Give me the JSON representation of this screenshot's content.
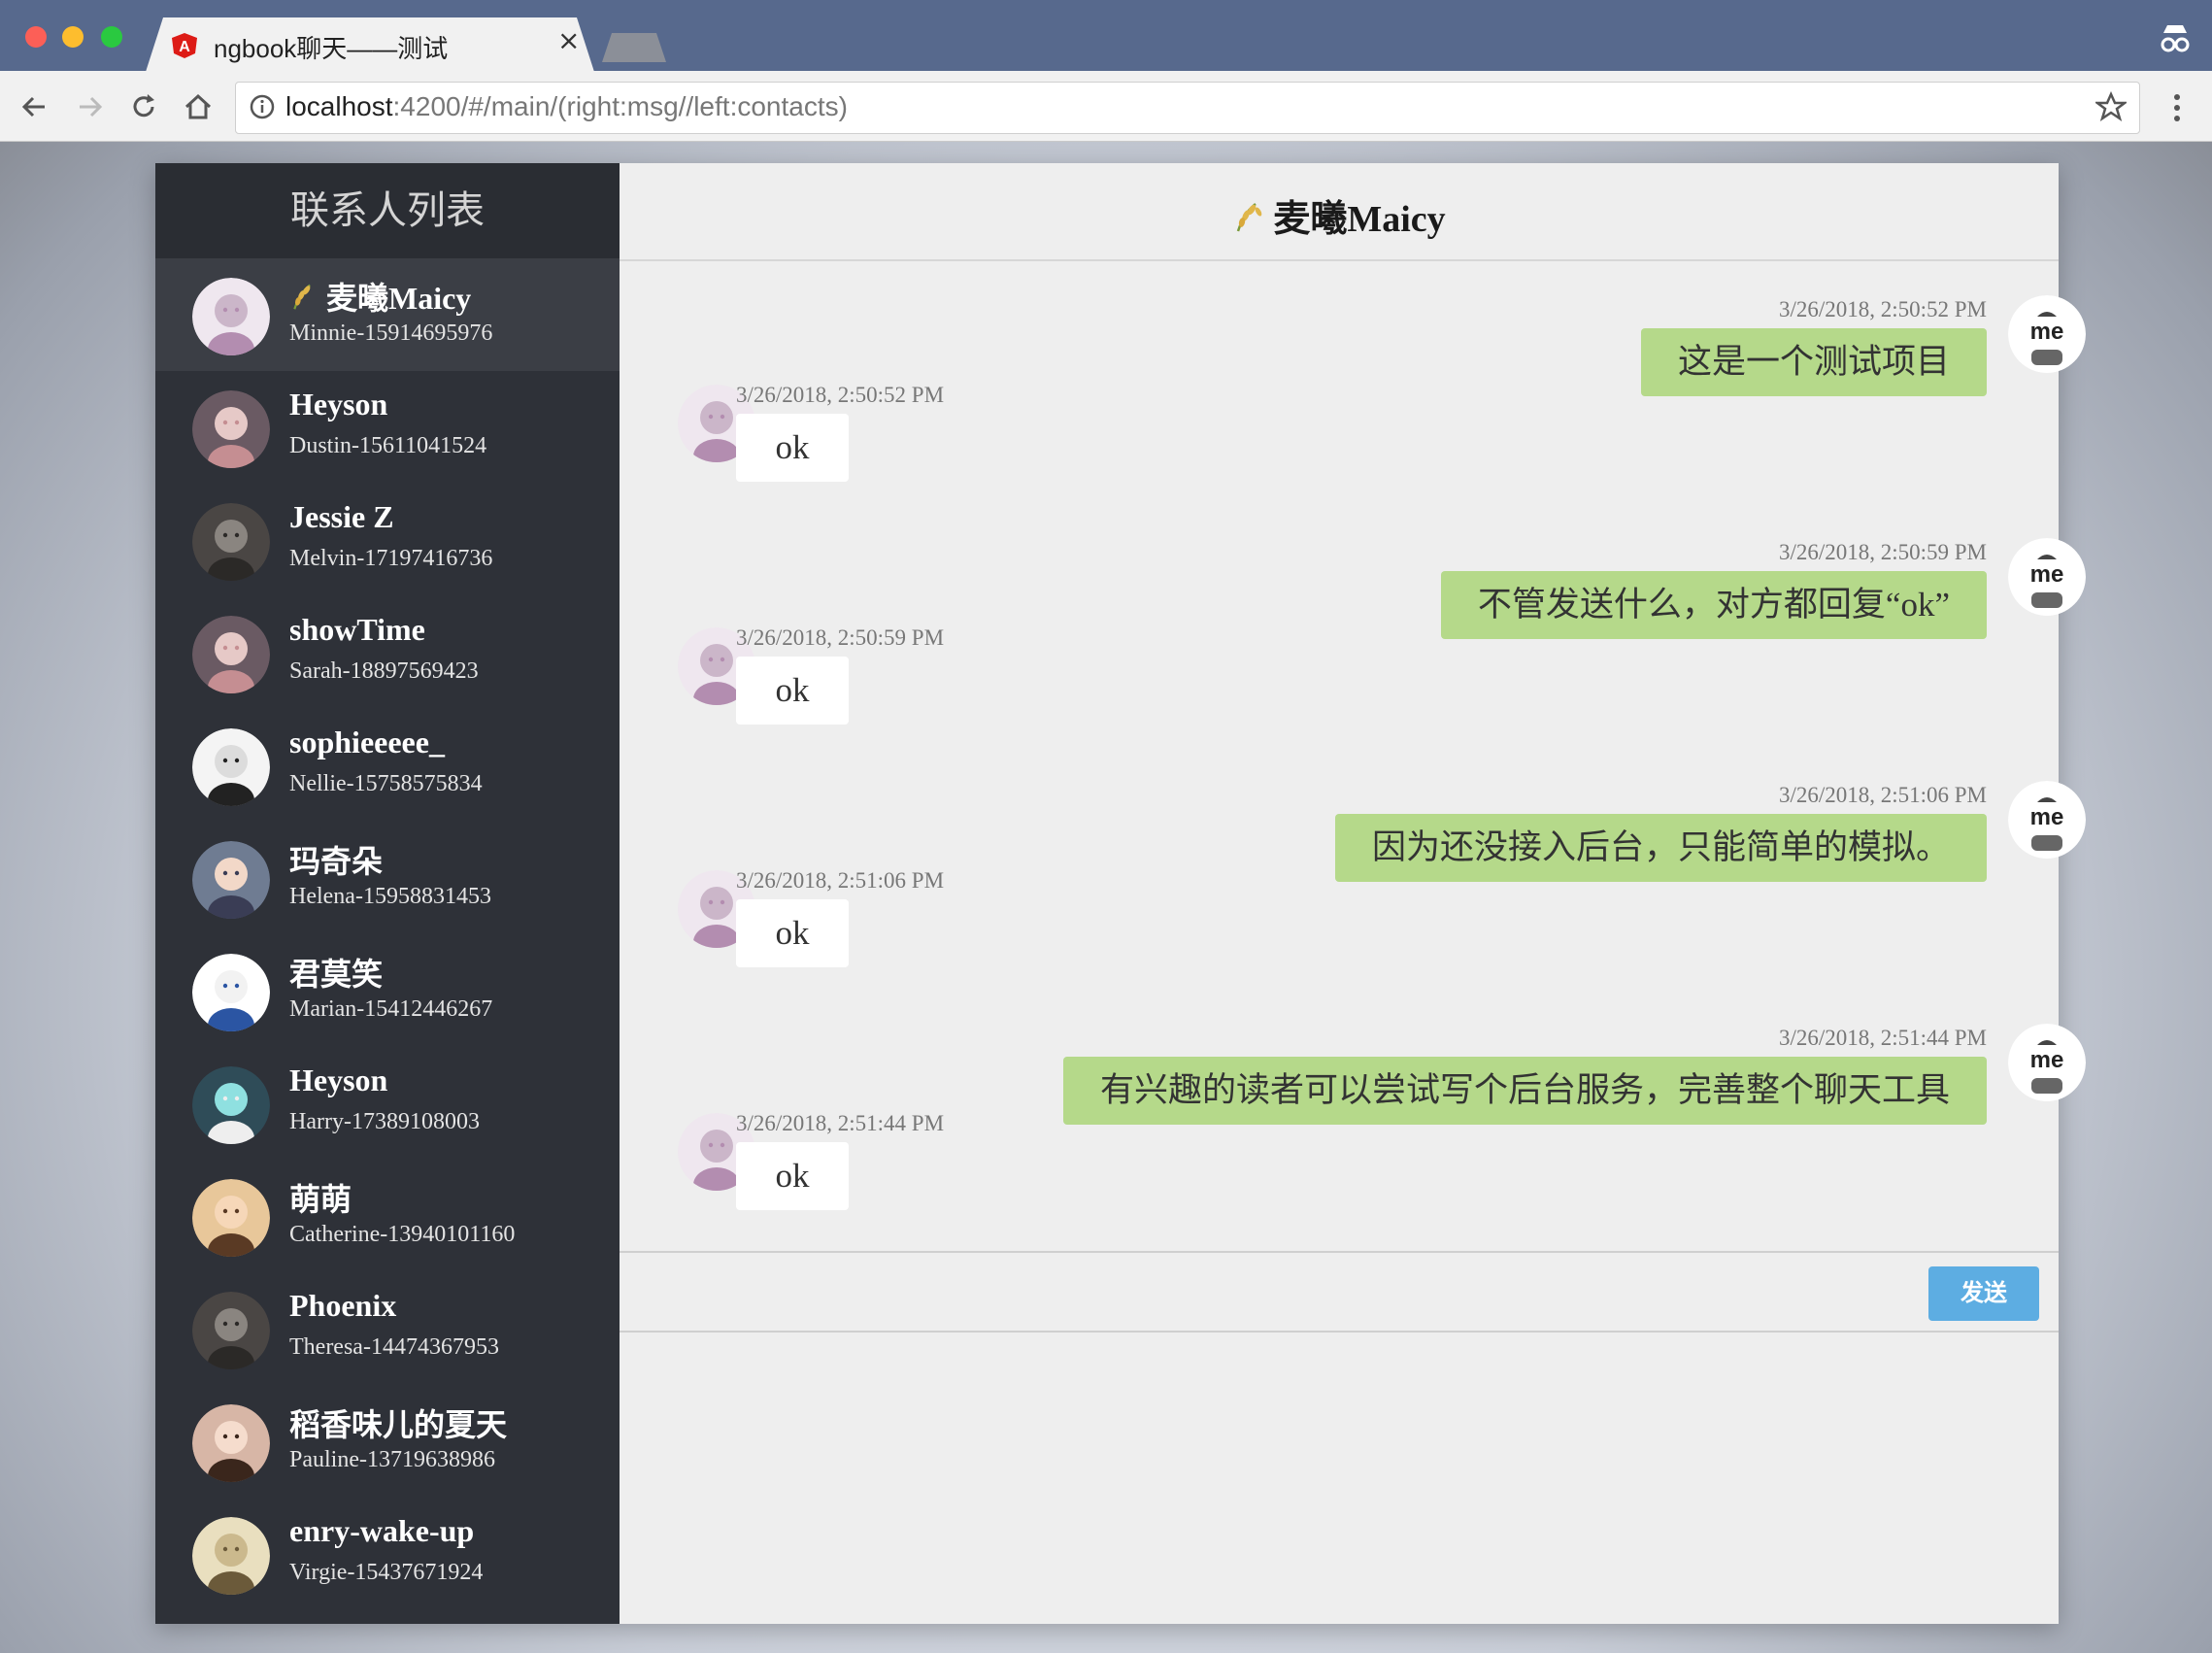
{
  "browser": {
    "tab_title": "ngbook聊天——测试",
    "url_host": "localhost",
    "url_rest": ":4200/#/main/(right:msg//left:contacts)"
  },
  "sidebar": {
    "title": "联系人列表",
    "contacts": [
      {
        "name": "麦曦Maicy",
        "phone": "Minnie-15914695976",
        "active": true
      },
      {
        "name": "Heyson",
        "phone": "Dustin-15611041524"
      },
      {
        "name": "Jessie Z",
        "phone": "Melvin-17197416736"
      },
      {
        "name": "showTime",
        "phone": "Sarah-18897569423"
      },
      {
        "name": "sophieeeee_",
        "phone": "Nellie-15758575834"
      },
      {
        "name": "玛奇朵",
        "phone": "Helena-15958831453"
      },
      {
        "name": "君莫笑",
        "phone": "Marian-15412446267"
      },
      {
        "name": "Heyson",
        "phone": "Harry-17389108003"
      },
      {
        "name": "萌萌",
        "phone": "Catherine-13940101160"
      },
      {
        "name": "Phoenix",
        "phone": "Theresa-14474367953"
      },
      {
        "name": "稻香味儿的夏天",
        "phone": "Pauline-13719638986"
      },
      {
        "name": "enry-wake-up",
        "phone": "Virgie-15437671924"
      }
    ]
  },
  "chat": {
    "title": "麦曦Maicy",
    "messages": [
      {
        "from": "me",
        "time": "3/26/2018, 2:50:52 PM",
        "text": "这是一个测试项目"
      },
      {
        "from": "them",
        "time": "3/26/2018, 2:50:52 PM",
        "text": "ok"
      },
      {
        "from": "me",
        "time": "3/26/2018, 2:50:59 PM",
        "text": "不管发送什么，对方都回复“ok”"
      },
      {
        "from": "them",
        "time": "3/26/2018, 2:50:59 PM",
        "text": "ok"
      },
      {
        "from": "me",
        "time": "3/26/2018, 2:51:06 PM",
        "text": "因为还没接入后台，只能简单的模拟。"
      },
      {
        "from": "them",
        "time": "3/26/2018, 2:51:06 PM",
        "text": "ok"
      },
      {
        "from": "me",
        "time": "3/26/2018, 2:51:44 PM",
        "text": "有兴趣的读者可以尝试写个后台服务，完善整个聊天工具"
      },
      {
        "from": "them",
        "time": "3/26/2018, 2:51:44 PM",
        "text": "ok"
      }
    ],
    "me_avatar_label": "me",
    "send_label": "发送"
  },
  "colors": {
    "sidebar_bg": "#2e3138",
    "my_bubble": "#b5d98a",
    "send_button": "#5dade2"
  }
}
